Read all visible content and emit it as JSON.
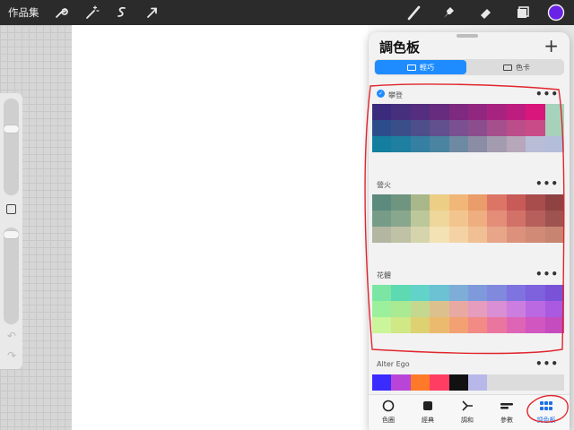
{
  "topbar": {
    "gallery_label": "作品集",
    "left_tools": [
      "wrench-icon",
      "magic-wand-icon",
      "selection-icon",
      "transform-arrow-icon"
    ],
    "right_tools": [
      "brush-icon",
      "smudge-icon",
      "eraser-icon",
      "layers-icon",
      "color-icon"
    ],
    "active_color": "#6a22e6"
  },
  "panel": {
    "title": "調色板",
    "add_label": "+",
    "segment_compact": "輕巧",
    "segment_cards": "色卡"
  },
  "palettes": [
    {
      "name": "攀登",
      "default": true,
      "rows": [
        [
          "#3a2b7c",
          "#46307e",
          "#552e7f",
          "#672c7e",
          "#7d2a80",
          "#922780",
          "#a82380",
          "#bd1d7f",
          "#d8167b",
          "#a6d3bb"
        ],
        [
          "#2d4d8a",
          "#3a4f8a",
          "#4d4e8a",
          "#614f8e",
          "#7a5090",
          "#8c4d8e",
          "#a64f8d",
          "#bb4d8a",
          "#c94b88",
          "#a7d2ba"
        ],
        [
          "#137e9e",
          "#1f7fa0",
          "#3580a2",
          "#4a84a1",
          "#6e8aa2",
          "#8b8da5",
          "#a39cb0",
          "#b6a7ba",
          "#b9bdd6",
          "#b3bedb"
        ]
      ]
    },
    {
      "name": "營火",
      "default": false,
      "rows": [
        [
          "#5c8a7c",
          "#6f9580",
          "#a8b88a",
          "#ecce85",
          "#f1b778",
          "#ea9c6a",
          "#dd7566",
          "#c85a58",
          "#a84c4c",
          "#8e4242"
        ],
        [
          "#769c88",
          "#89a78d",
          "#bcc79a",
          "#efd69b",
          "#f3c58e",
          "#eeae80",
          "#e48d78",
          "#d27168",
          "#b65f5b",
          "#9e5350"
        ],
        [
          "#b3b6a0",
          "#c0c2a6",
          "#d6d4ad",
          "#f2e2b4",
          "#f5d2a4",
          "#f1bf94",
          "#e8a588",
          "#dc917c",
          "#d08a76",
          "#c78470"
        ]
      ]
    },
    {
      "name": "花體",
      "default": false,
      "rows": [
        [
          "#7be6a4",
          "#5ddab1",
          "#62d3c8",
          "#6cc1d2",
          "#7eadd8",
          "#7f9adb",
          "#8089de",
          "#7f73df",
          "#7d61dd",
          "#7a52d8"
        ],
        [
          "#9cf09c",
          "#aaea93",
          "#c4d890",
          "#dcc18e",
          "#e8a9a2",
          "#e69cbc",
          "#da8ed3",
          "#cc7ee0",
          "#ba69e2",
          "#a95ae0"
        ],
        [
          "#caf59a",
          "#d0e885",
          "#ddd172",
          "#ecba6f",
          "#f3a173",
          "#f28a86",
          "#ea76a0",
          "#de65b5",
          "#d156c0",
          "#c54cbf"
        ]
      ]
    },
    {
      "name": "Alter Ego",
      "default": false,
      "rows": [
        [
          "#3a2bff",
          "#b945d8",
          "#ff7a28",
          "#ff3d63",
          "#111111",
          "#b7b7ea",
          "#dcdcdc",
          "#dcdcdc",
          "#dcdcdc",
          "#dcdcdc"
        ]
      ]
    }
  ],
  "tabs": [
    {
      "label": "色圈",
      "icon": "color-disc-icon"
    },
    {
      "label": "經典",
      "icon": "classic-square-icon"
    },
    {
      "label": "調和",
      "icon": "harmony-icon"
    },
    {
      "label": "參數",
      "icon": "value-sliders-icon"
    },
    {
      "label": "調色板",
      "icon": "palette-grid-icon"
    }
  ],
  "selected_tab": "調色板",
  "colors": {
    "accent": "#1e8cff",
    "annotation": "#e0262e"
  }
}
